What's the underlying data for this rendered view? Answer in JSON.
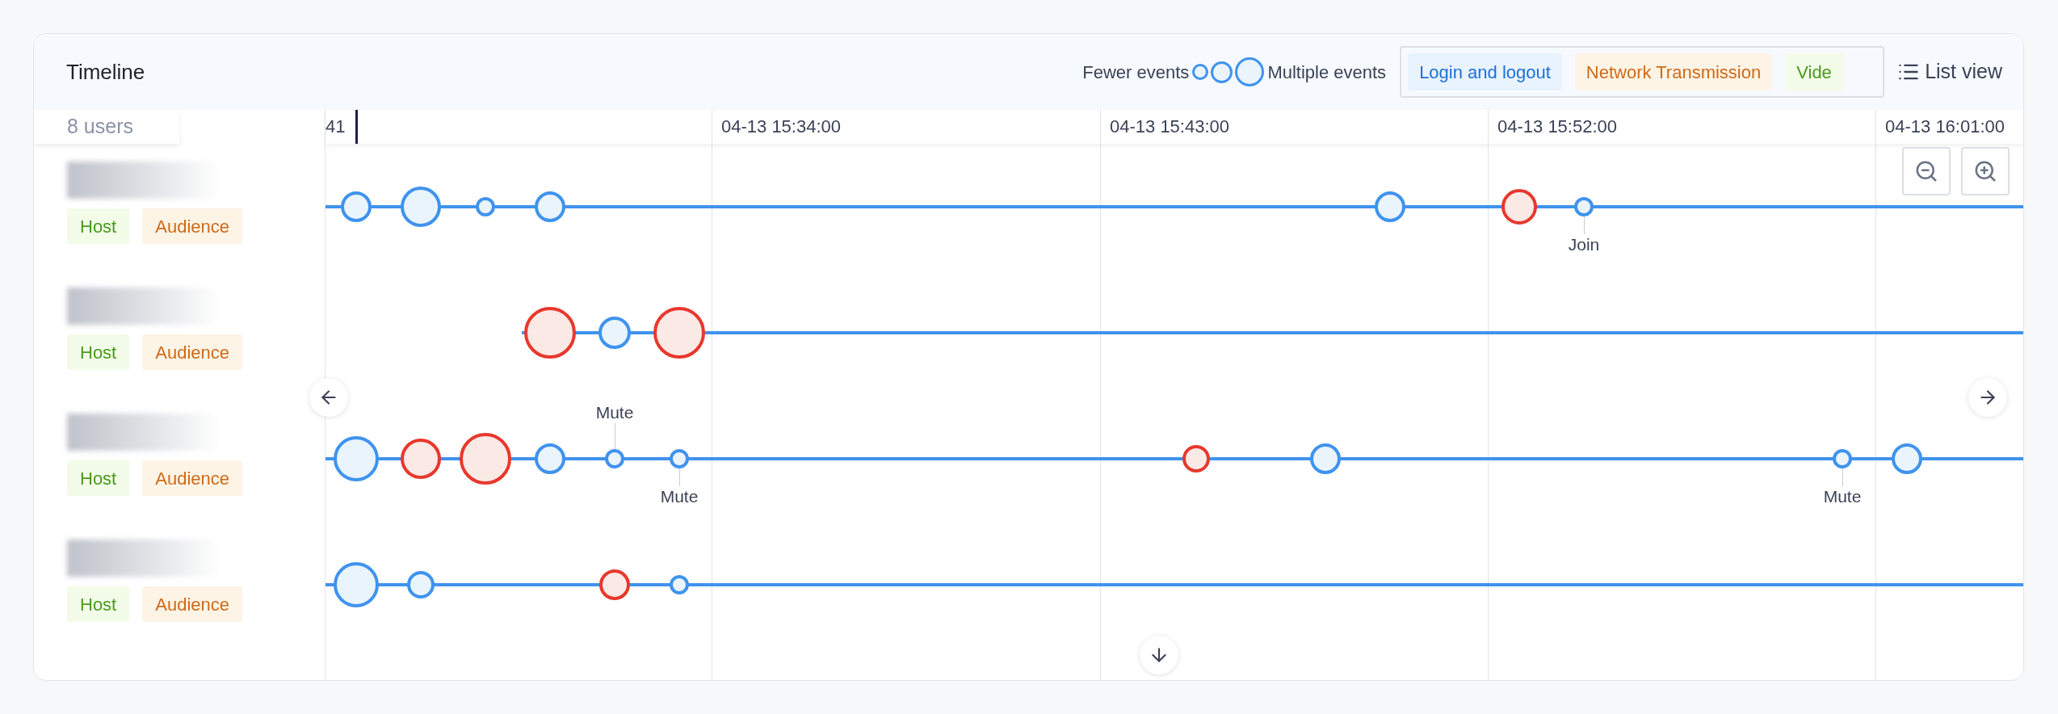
{
  "title": "Timeline",
  "legend": {
    "fewer": "Fewer events",
    "multiple": "Multiple events"
  },
  "categories": [
    {
      "label": "Login and logout",
      "kind": "login"
    },
    {
      "label": "Network Transmission",
      "kind": "network"
    },
    {
      "label": "Vide",
      "kind": "video"
    }
  ],
  "list_view": "List view",
  "user_count": "8 users",
  "axis_ticks": [
    "41",
    "04-13 15:34:00",
    "04-13 15:43:00",
    "04-13 15:52:00",
    "04-13 16:01:00"
  ],
  "users": [
    {
      "roles": [
        {
          "label": "Host",
          "kind": "host"
        },
        {
          "label": "Audience",
          "kind": "audience"
        }
      ],
      "events": [
        {
          "kind": "login"
        },
        {
          "kind": "login"
        },
        {
          "kind": "login"
        },
        {
          "kind": "login"
        },
        {
          "kind": "login"
        },
        {
          "kind": "network"
        },
        {
          "kind": "login",
          "label": "Join",
          "label_above": false
        }
      ]
    },
    {
      "roles": [
        {
          "label": "Host",
          "kind": "host"
        },
        {
          "label": "Audience",
          "kind": "audience"
        }
      ],
      "events": [
        {
          "kind": "network"
        },
        {
          "kind": "login"
        },
        {
          "kind": "network"
        }
      ]
    },
    {
      "roles": [
        {
          "label": "Host",
          "kind": "host"
        },
        {
          "label": "Audience",
          "kind": "audience"
        }
      ],
      "events": [
        {
          "kind": "login"
        },
        {
          "kind": "network"
        },
        {
          "kind": "network"
        },
        {
          "kind": "login"
        },
        {
          "kind": "login",
          "label": "Mute",
          "label_above": true
        },
        {
          "kind": "login",
          "label": "Mute",
          "label_above": false
        },
        {
          "kind": "network"
        },
        {
          "kind": "login"
        },
        {
          "kind": "login",
          "label": "Mute",
          "label_above": false
        },
        {
          "kind": "login"
        }
      ]
    },
    {
      "roles": [
        {
          "label": "Host",
          "kind": "host"
        },
        {
          "label": "Audience",
          "kind": "audience"
        }
      ],
      "events": [
        {
          "kind": "login"
        },
        {
          "kind": "login"
        },
        {
          "kind": "network"
        },
        {
          "kind": "login"
        }
      ]
    }
  ]
}
